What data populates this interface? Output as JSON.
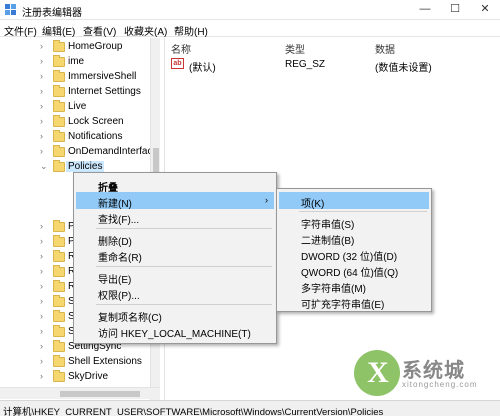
{
  "window": {
    "title": "注册表编辑器",
    "minimize_glyph": "—",
    "maximize_glyph": "☐",
    "close_glyph": "✕"
  },
  "menu": [
    "文件(F)",
    "编辑(E)",
    "查看(V)",
    "收藏夹(A)",
    "帮助(H)"
  ],
  "tree": {
    "items": [
      {
        "label": "HomeGroup",
        "expander": "›"
      },
      {
        "label": "ime",
        "expander": "›"
      },
      {
        "label": "ImmersiveShell",
        "expander": "›"
      },
      {
        "label": "Internet Settings",
        "expander": "›"
      },
      {
        "label": "Live",
        "expander": "›"
      },
      {
        "label": "Lock Screen",
        "expander": "›"
      },
      {
        "label": "Notifications",
        "expander": "›"
      },
      {
        "label": "OnDemandInterfac",
        "expander": "›"
      },
      {
        "label": "Policies",
        "expander": "⌄"
      },
      {
        "label": "P",
        "expander": "›"
      },
      {
        "label": "P",
        "expander": "›"
      },
      {
        "label": "R",
        "expander": "›"
      },
      {
        "label": "R",
        "expander": "›"
      },
      {
        "label": "R",
        "expander": "›"
      },
      {
        "label": "S",
        "expander": "›"
      },
      {
        "label": "S",
        "expander": "›"
      },
      {
        "label": "S",
        "expander": "›"
      },
      {
        "label": "SettingSync",
        "expander": "›"
      },
      {
        "label": "Shell Extensions",
        "expander": "›"
      },
      {
        "label": "SkyDrive",
        "expander": "›"
      }
    ]
  },
  "list": {
    "columns": [
      "名称",
      "类型",
      "数据"
    ],
    "rows": [
      {
        "icon": "ab",
        "name": "(默认)",
        "type": "REG_SZ",
        "data": "(数值未设置)"
      }
    ]
  },
  "status": {
    "path": "计算机\\HKEY_CURRENT_USER\\SOFTWARE\\Microsoft\\Windows\\CurrentVersion\\Policies"
  },
  "context_menu": {
    "items": [
      {
        "label": "折叠"
      },
      {
        "label": "新建(N)",
        "arrow": "›"
      },
      {
        "label": "查找(F)..."
      },
      {
        "label": "删除(D)"
      },
      {
        "label": "重命名(R)"
      },
      {
        "label": "导出(E)"
      },
      {
        "label": "权限(P)..."
      },
      {
        "label": "复制项名称(C)"
      },
      {
        "label": "访问 HKEY_LOCAL_MACHINE(T)"
      }
    ]
  },
  "submenu": {
    "items": [
      {
        "label": "项(K)"
      },
      {
        "label": "字符串值(S)"
      },
      {
        "label": "二进制值(B)"
      },
      {
        "label": "DWORD (32 位)值(D)"
      },
      {
        "label": "QWORD (64 位)值(Q)"
      },
      {
        "label": "多字符串值(M)"
      },
      {
        "label": "可扩充字符串值(E)"
      }
    ]
  },
  "watermark": {
    "mark": "X",
    "brand": "系统城",
    "domain": "xitongcheng.com"
  },
  "colors": {
    "highlight": "#91c9f7",
    "selection": "#cce8ff",
    "folder": "#f5d66f"
  }
}
